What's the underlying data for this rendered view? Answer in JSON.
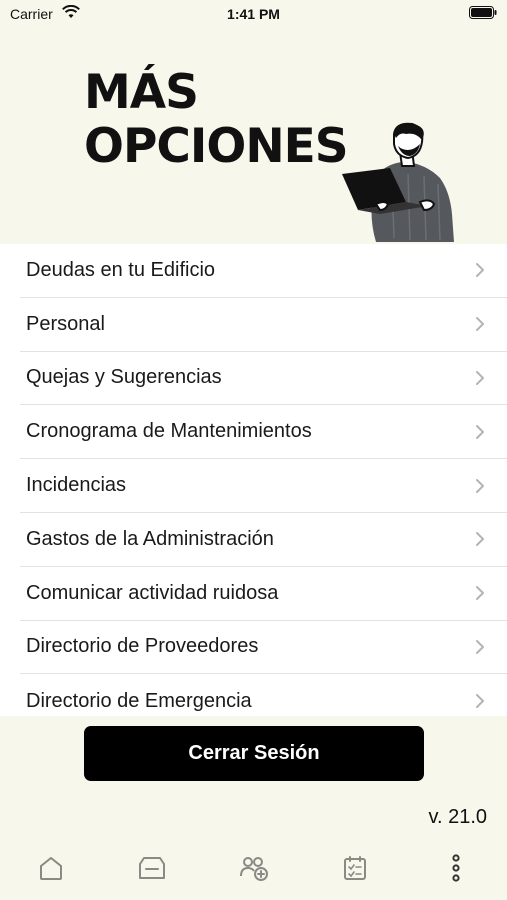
{
  "status_bar": {
    "carrier": "Carrier",
    "time": "1:41 PM"
  },
  "hero": {
    "title_line1": "MÁS",
    "title_line2": "OPCIONES"
  },
  "menu": {
    "items": [
      {
        "label": "Deudas en tu Edificio"
      },
      {
        "label": "Personal"
      },
      {
        "label": "Quejas y Sugerencias"
      },
      {
        "label": "Cronograma de Mantenimientos"
      },
      {
        "label": "Incidencias"
      },
      {
        "label": "Gastos de la Administración"
      },
      {
        "label": "Comunicar actividad ruidosa"
      },
      {
        "label": "Directorio de Proveedores"
      },
      {
        "label": "Directorio de Emergencia"
      }
    ]
  },
  "logout": {
    "label": "Cerrar Sesión"
  },
  "version": "v. 21.0",
  "tab_bar": {
    "tabs": [
      {
        "icon": "home-icon"
      },
      {
        "icon": "inbox-icon"
      },
      {
        "icon": "add-user-icon"
      },
      {
        "icon": "checklist-icon"
      },
      {
        "icon": "more-vertical-icon"
      }
    ]
  },
  "colors": {
    "background": "#f8f7ec",
    "button": "#000000",
    "list_background": "#ffffff"
  }
}
